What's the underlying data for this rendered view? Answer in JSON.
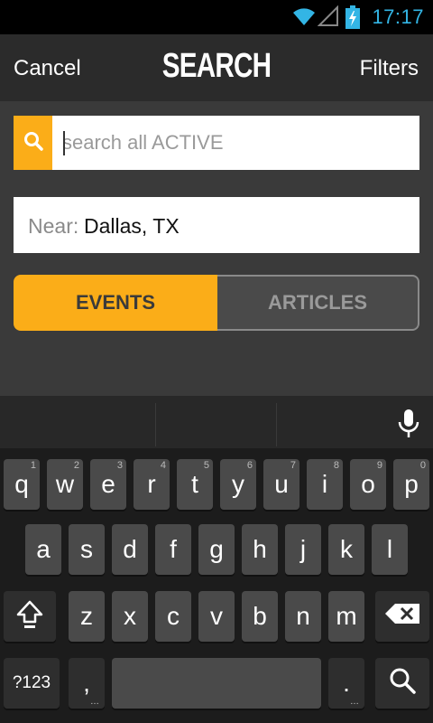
{
  "status_bar": {
    "time": "17:17",
    "icons": [
      "wifi-icon",
      "signal-icon",
      "battery-charging-icon"
    ],
    "accent_color": "#33b5e5"
  },
  "header": {
    "cancel_label": "Cancel",
    "title": "SEARCH",
    "filters_label": "Filters"
  },
  "search": {
    "placeholder": "search all ACTIVE",
    "value": "",
    "icon": "search-icon",
    "accent_color": "#fbad18"
  },
  "near": {
    "label": "Near:",
    "value": "Dallas, TX"
  },
  "tabs": [
    {
      "label": "EVENTS",
      "selected": true
    },
    {
      "label": "ARTICLES",
      "selected": false
    }
  ],
  "keyboard": {
    "row1": [
      {
        "k": "q",
        "h": "1"
      },
      {
        "k": "w",
        "h": "2"
      },
      {
        "k": "e",
        "h": "3"
      },
      {
        "k": "r",
        "h": "4"
      },
      {
        "k": "t",
        "h": "5"
      },
      {
        "k": "y",
        "h": "6"
      },
      {
        "k": "u",
        "h": "7"
      },
      {
        "k": "i",
        "h": "8"
      },
      {
        "k": "o",
        "h": "9"
      },
      {
        "k": "p",
        "h": "0"
      }
    ],
    "row2": [
      "a",
      "s",
      "d",
      "f",
      "g",
      "h",
      "j",
      "k",
      "l"
    ],
    "row3": [
      "z",
      "x",
      "c",
      "v",
      "b",
      "n",
      "m"
    ],
    "symbols_label": "?123",
    "comma": ",",
    "period": ".",
    "mic_icon": "mic-icon",
    "shift_icon": "shift-icon",
    "delete_icon": "backspace-icon",
    "search_key_icon": "search-icon"
  }
}
